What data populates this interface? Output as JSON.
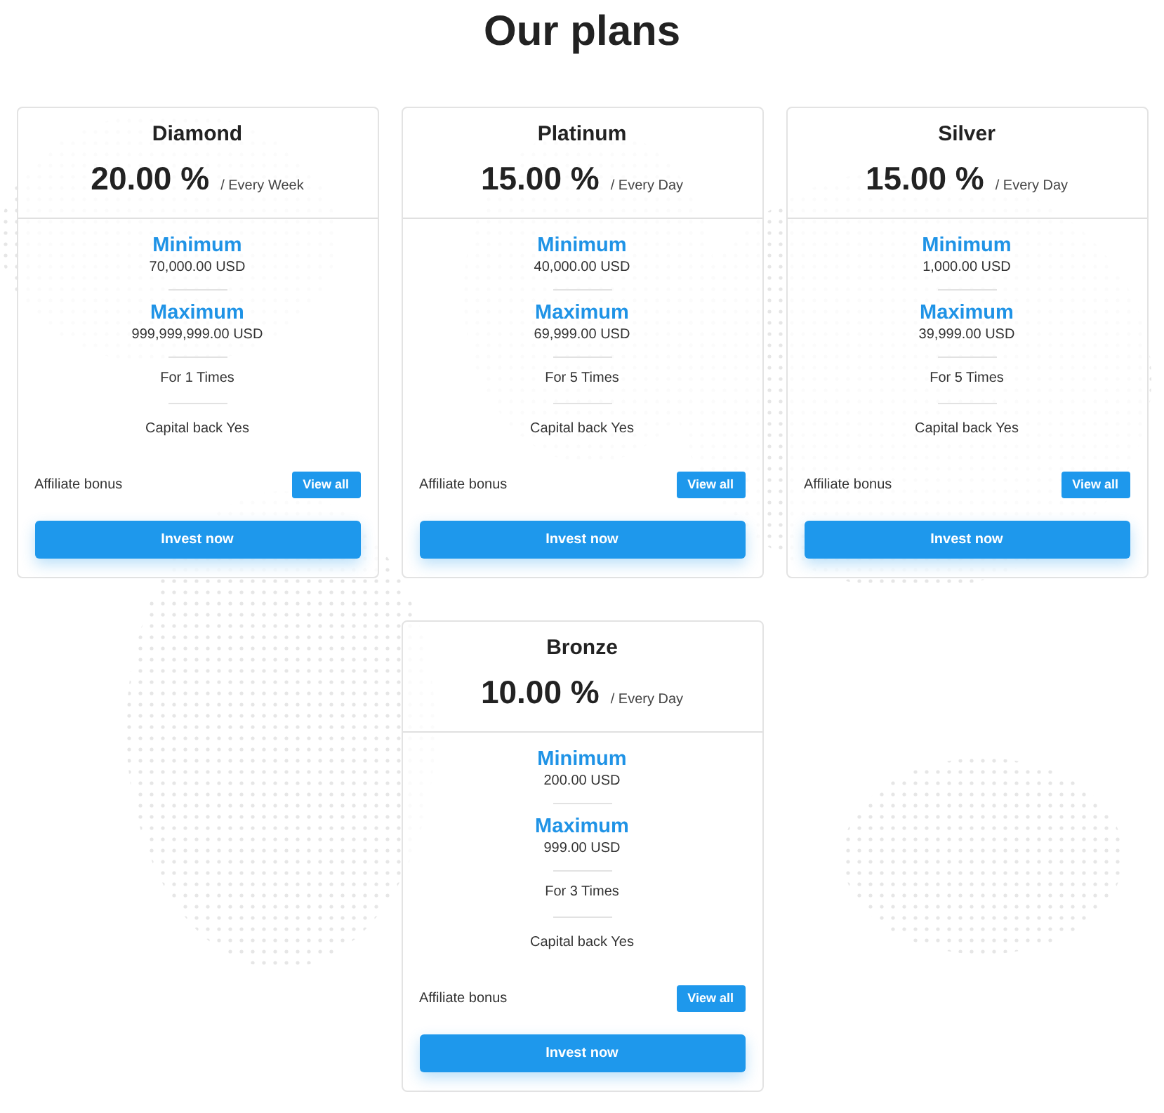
{
  "title": "Our plans",
  "plans": [
    {
      "name": "Diamond",
      "rate": "20.00 %",
      "period": "/ Every Week",
      "minimum_label": "Minimum",
      "minimum": "70,000.00 USD",
      "maximum_label": "Maximum",
      "maximum": "999,999,999.00 USD",
      "times": "For 1 Times",
      "capital_back": "Capital back Yes",
      "affiliate_label": "Affiliate bonus",
      "view_button": "View all",
      "invest_button": "Invest now"
    },
    {
      "name": "Platinum",
      "rate": "15.00 %",
      "period": "/ Every Day",
      "minimum_label": "Minimum",
      "minimum": "40,000.00 USD",
      "maximum_label": "Maximum",
      "maximum": "69,999.00 USD",
      "times": "For 5 Times",
      "capital_back": "Capital back Yes",
      "affiliate_label": "Affiliate bonus",
      "view_button": "View all",
      "invest_button": "Invest now"
    },
    {
      "name": "Silver",
      "rate": "15.00 %",
      "period": "/ Every Day",
      "minimum_label": "Minimum",
      "minimum": "1,000.00 USD",
      "maximum_label": "Maximum",
      "maximum": "39,999.00 USD",
      "times": "For 5 Times",
      "capital_back": "Capital back Yes",
      "affiliate_label": "Affiliate bonus",
      "view_button": "View all",
      "invest_button": "Invest now"
    },
    {
      "name": "Bronze",
      "rate": "10.00 %",
      "period": "/ Every Day",
      "minimum_label": "Minimum",
      "minimum": "200.00 USD",
      "maximum_label": "Maximum",
      "maximum": "999.00 USD",
      "times": "For 3 Times",
      "capital_back": "Capital back Yes",
      "affiliate_label": "Affiliate bonus",
      "view_button": "View all",
      "invest_button": "Invest now"
    }
  ]
}
